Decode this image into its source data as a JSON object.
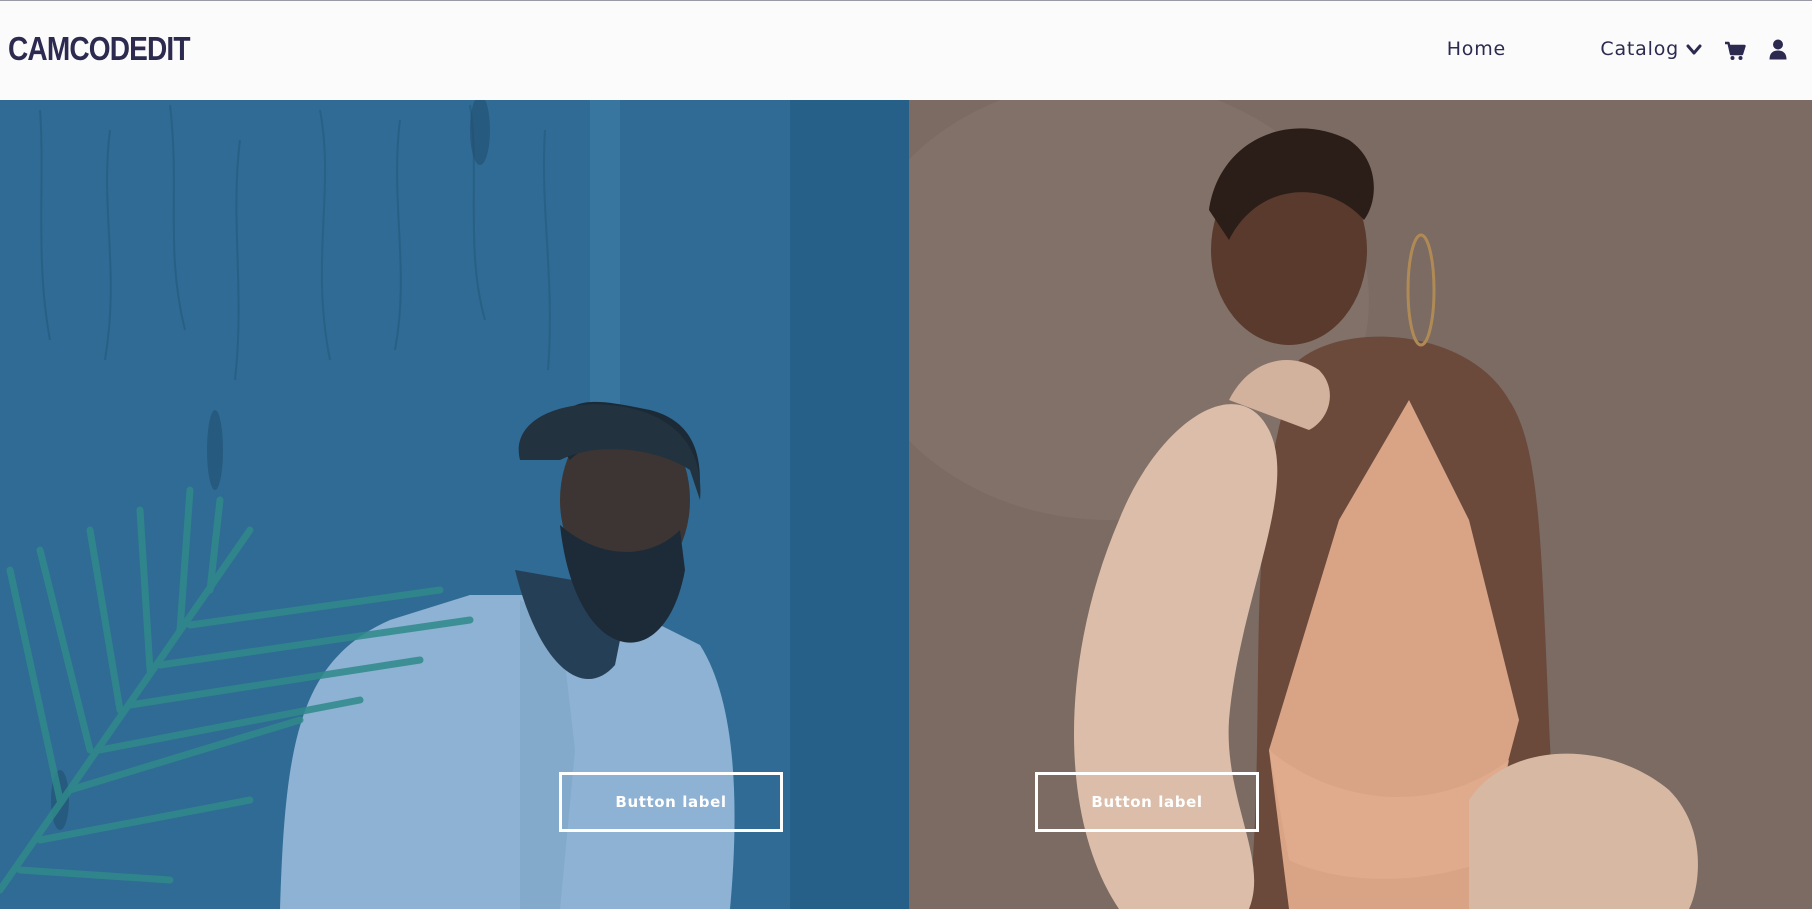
{
  "brand": {
    "logo_text": "CAMCODEDIT"
  },
  "nav": {
    "home_label": "Home",
    "catalog_label": "Catalog",
    "icons": [
      "chevron-down-icon",
      "cart-icon",
      "user-icon"
    ]
  },
  "hero": {
    "left_button_label": "Button label",
    "right_button_label": "Button label"
  },
  "colors": {
    "brand_navy": "#2c2a4e",
    "left_overlay": "#2d6c97",
    "right_overlay": "#7a6a62",
    "button_border": "#ffffff"
  }
}
